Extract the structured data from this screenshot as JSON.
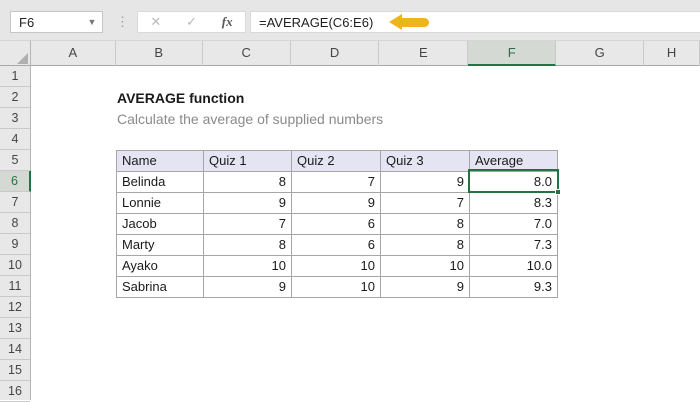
{
  "toolbar": {
    "name_box": "F6",
    "cancel_glyph": "✕",
    "enter_glyph": "✓",
    "fx_glyph": "fx",
    "formula": "=AVERAGE(C6:E6)"
  },
  "grid": {
    "column_headers": [
      "A",
      "B",
      "C",
      "D",
      "E",
      "F",
      "G",
      "H"
    ],
    "row_headers": [
      "1",
      "2",
      "3",
      "4",
      "5",
      "6",
      "7",
      "8",
      "9",
      "10",
      "11",
      "12",
      "13",
      "14",
      "15",
      "16"
    ],
    "selected_column": "F",
    "selected_row": "6",
    "selected_cell": "F6",
    "selected_cell_value": "8.0"
  },
  "content": {
    "title": "AVERAGE function",
    "subtitle": "Calculate the average of supplied numbers"
  },
  "table": {
    "headers": [
      "Name",
      "Quiz 1",
      "Quiz 2",
      "Quiz 3",
      "Average"
    ],
    "rows": [
      [
        "Belinda",
        "8",
        "7",
        "9",
        "8.0"
      ],
      [
        "Lonnie",
        "9",
        "9",
        "7",
        "8.3"
      ],
      [
        "Jacob",
        "7",
        "6",
        "8",
        "7.0"
      ],
      [
        "Marty",
        "8",
        "6",
        "8",
        "7.3"
      ],
      [
        "Ayako",
        "10",
        "10",
        "10",
        "10.0"
      ],
      [
        "Sabrina",
        "9",
        "10",
        "9",
        "9.3"
      ]
    ]
  },
  "colors": {
    "selection_green": "#217346",
    "arrow_gold": "#EDB41C",
    "table_header_fill": "#E4E4F2",
    "header_strip_fill": "#E8E8E8",
    "selected_header_fill": "#D4D9D4",
    "table_border": "#A6A6A6"
  }
}
